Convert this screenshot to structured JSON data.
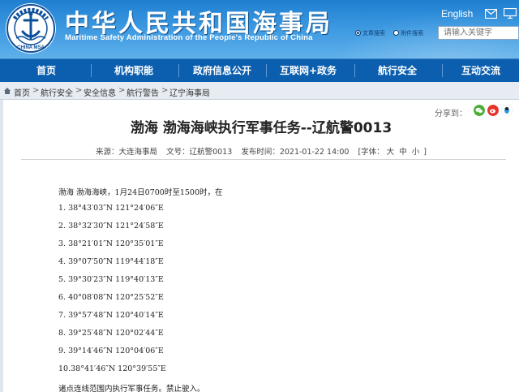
{
  "header": {
    "cn_title": "中华人民共和国海事局",
    "en_title": "Maritime Safety Administration of the People's Republic of China",
    "english_link": "English",
    "search_radio": [
      "文章搜索",
      "附件搜索"
    ],
    "search_placeholder": "请输入关键字",
    "logo_ring_text": "中华人民共和国海事局",
    "logo_bottom_text": "CHINA MSA",
    "logo_color": "#0d4f99",
    "header_color": "#2a8ad6",
    "nav_color": "#0b5fae"
  },
  "nav": [
    "首页",
    "机构职能",
    "政府信息公开",
    "互联网+政务",
    "航行安全",
    "互动交流"
  ],
  "breadcrumb": [
    "首页",
    "航行安全",
    "安全信息",
    "航行警告",
    "辽宁海事局"
  ],
  "share": {
    "label": "分享到：",
    "icons": [
      "wechat-icon",
      "weibo-icon",
      "qq-icon"
    ]
  },
  "article": {
    "title": "渤海 渤海海峡执行军事任务--辽航警0013",
    "meta": {
      "source": "来源：大连海事局",
      "doc_no": "文号：辽航警0013",
      "published": "发布时间：2021-01-22 14:00",
      "font_label": "[字体：",
      "font_sizes": [
        "大",
        "中",
        "小"
      ],
      "font_close": "]"
    },
    "intro": "渤海 渤海海峡，1月24日0700时至1500时，在",
    "points": [
      "1. 38°43′03″N 121°24′06″E",
      "2. 38°32′30″N 121°24′58″E",
      "3. 38°21′01″N 120°35′01″E",
      "4. 39°07′50″N 119°44′18″E",
      "5. 39°30′23″N 119°40′13″E",
      "6. 40°08′08″N 120°25′52″E",
      "7. 39°57′48″N 120°40′14″E",
      "8. 39°25′48″N 120°02′44″E",
      "9. 39°14′46″N 120°04′06″E",
      "10.38°41′46″N 120°39′55″E"
    ],
    "closing": "诸点连线范围内执行军事任务。禁止驶入。"
  }
}
